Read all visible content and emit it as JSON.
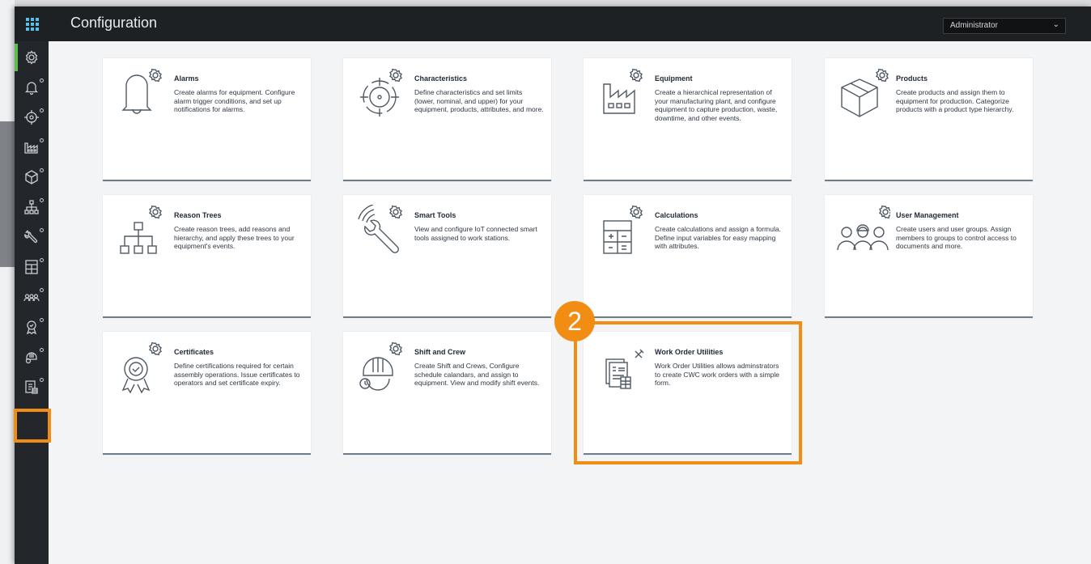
{
  "header": {
    "title": "Configuration",
    "role_selected": "Administrator"
  },
  "sidebar": {
    "items": [
      {
        "icon": "gear-icon"
      },
      {
        "icon": "bell-icon"
      },
      {
        "icon": "target-icon"
      },
      {
        "icon": "factory-icon"
      },
      {
        "icon": "box-icon"
      },
      {
        "icon": "hierarchy-icon"
      },
      {
        "icon": "wrench-wifi-icon"
      },
      {
        "icon": "calculator-icon"
      },
      {
        "icon": "users-icon"
      },
      {
        "icon": "certificate-icon"
      },
      {
        "icon": "hardhat-icon"
      },
      {
        "icon": "work-order-icon"
      }
    ]
  },
  "cards": [
    {
      "title": "Alarms",
      "description": "Create alarms for equipment. Configure alarm trigger conditions, and set up notifications for alarms."
    },
    {
      "title": "Characteristics",
      "description": "Define characteristics and set limits (lower, nominal, and upper) for your equipment, products, attributes, and more."
    },
    {
      "title": "Equipment",
      "description": "Create a hierarchical representation of your manufacturing plant, and configure equipment to capture production, waste, downtime, and other events."
    },
    {
      "title": "Products",
      "description": "Create products and assign them to equipment for production. Categorize products with a product type hierarchy."
    },
    {
      "title": "Reason Trees",
      "description": "Create reason trees, add reasons and hierarchy, and apply these trees to your equipment's events."
    },
    {
      "title": "Smart Tools",
      "description": "View and configure IoT connected smart tools assigned to work stations."
    },
    {
      "title": "Calculations",
      "description": "Create calculations and assign a formula. Define input variables for easy mapping with attributes."
    },
    {
      "title": "User Management",
      "description": "Create users and user groups. Assign members to groups to control access to documents and more."
    },
    {
      "title": "Certificates",
      "description": "Define certifications required for certain assembly operations. Issue certificates to operators and set certificate expiry."
    },
    {
      "title": "Shift and Crew",
      "description": "Create Shift and Crews, Configure schedule calandars, and assign to equipment. View and modify shift events."
    },
    {
      "title": "Work Order Utilities",
      "description": "Work Order Utilities allows adminstrators to create CWC work orders with a simple form."
    }
  ],
  "annotation": {
    "step_number": "2",
    "color": "#f28d13"
  }
}
